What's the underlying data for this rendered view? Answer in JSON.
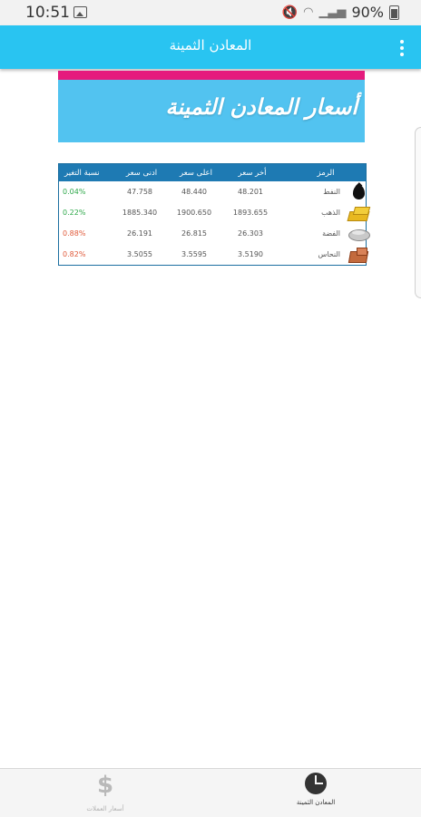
{
  "status_bar": {
    "time": "10:51",
    "battery": "90%"
  },
  "app_bar": {
    "title": "المعادن الثمينة"
  },
  "banner": {
    "title": "أسعار المعادن الثمينة"
  },
  "table": {
    "headers": {
      "symbol": "الرمز",
      "last": "أخر سعر",
      "high": "اعلى سعر",
      "low": "ادنى سعر",
      "change": "نسبة التغير"
    },
    "rows": [
      {
        "name": "النفط",
        "icon": "oil-drop-icon",
        "last": "48.201",
        "high": "48.440",
        "low": "47.758",
        "change": "0.04%",
        "trend": "up"
      },
      {
        "name": "الذهب",
        "icon": "gold-bars-icon",
        "last": "1893.655",
        "high": "1900.650",
        "low": "1885.340",
        "change": "0.22%",
        "trend": "up"
      },
      {
        "name": "الفضة",
        "icon": "silver-disc-icon",
        "last": "26.303",
        "high": "26.815",
        "low": "26.191",
        "change": "0.88%",
        "trend": "down"
      },
      {
        "name": "النحاس",
        "icon": "copper-icon",
        "last": "3.5190",
        "high": "3.5595",
        "low": "3.5055",
        "change": "0.82%",
        "trend": "down"
      }
    ]
  },
  "bottom_nav": {
    "currencies_label": "أسعار العملات",
    "metals_label": "المعادن الثمينة"
  },
  "colors": {
    "app_bar": "#29c4f1",
    "banner": "#52c3f0",
    "banner_stripe": "#e51b7d",
    "table_header": "#1e7ab3",
    "positive": "#2ea84a",
    "negative": "#e05a3a"
  }
}
